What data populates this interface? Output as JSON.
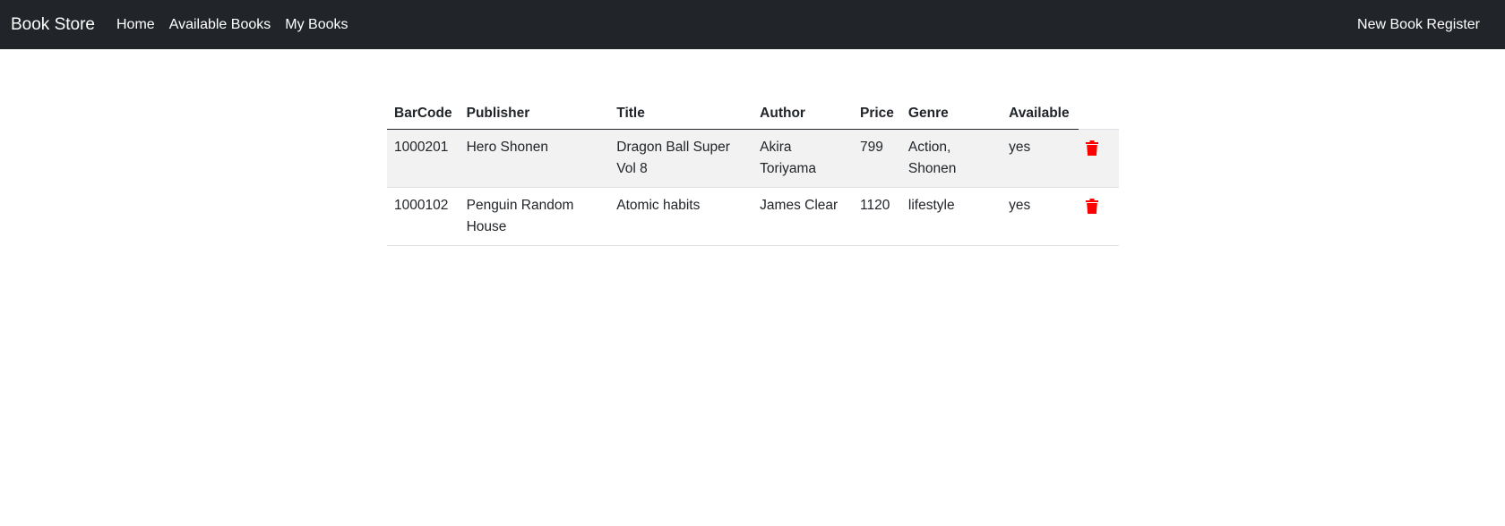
{
  "navbar": {
    "brand": "Book Store",
    "links": [
      "Home",
      "Available Books",
      "My Books"
    ],
    "right_link": "New Book Register"
  },
  "table": {
    "headers": [
      "BarCode",
      "Publisher",
      "Title",
      "Author",
      "Price",
      "Genre",
      "Available"
    ],
    "rows": [
      {
        "barcode": "1000201",
        "publisher": "Hero Shonen",
        "title": "Dragon Ball Super Vol 8",
        "author": "Akira Toriyama",
        "price": "799",
        "genre": "Action, Shonen",
        "available": "yes",
        "action_icon": "trash-icon"
      },
      {
        "barcode": "1000102",
        "publisher": "Penguin Random House",
        "title": "Atomic habits",
        "author": "James Clear",
        "price": "1120",
        "genre": "lifestyle",
        "available": "yes",
        "action_icon": "trash-icon"
      }
    ]
  },
  "colors": {
    "navbar_bg": "#212529",
    "delete_icon": "#ff0000",
    "stripe": "#f2f2f2"
  }
}
